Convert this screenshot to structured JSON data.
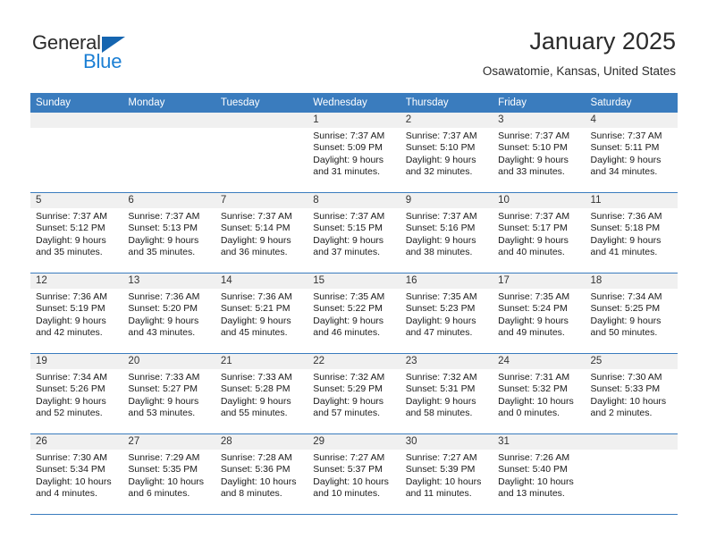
{
  "brand": {
    "word1": "General",
    "word2": "Blue",
    "flag_icon": "triangle-flag-icon",
    "colors": {
      "blue": "#1b7fd4",
      "flag": "#1565b0",
      "dark": "#2b2b2b"
    }
  },
  "header": {
    "title": "January 2025",
    "subtitle": "Osawatomie, Kansas, United States"
  },
  "theme": {
    "header_bar": "#3a7cbe",
    "day_head_bg": "#f0f0f0",
    "cell_bg": "#ffffff",
    "text": "#1a1a1a"
  },
  "weekdays": [
    "Sunday",
    "Monday",
    "Tuesday",
    "Wednesday",
    "Thursday",
    "Friday",
    "Saturday"
  ],
  "weeks": [
    [
      {
        "date": "",
        "empty": true,
        "lines": []
      },
      {
        "date": "",
        "empty": true,
        "lines": []
      },
      {
        "date": "",
        "empty": true,
        "lines": []
      },
      {
        "date": "1",
        "empty": false,
        "lines": [
          "Sunrise: 7:37 AM",
          "Sunset: 5:09 PM",
          "Daylight: 9 hours",
          "and 31 minutes."
        ]
      },
      {
        "date": "2",
        "empty": false,
        "lines": [
          "Sunrise: 7:37 AM",
          "Sunset: 5:10 PM",
          "Daylight: 9 hours",
          "and 32 minutes."
        ]
      },
      {
        "date": "3",
        "empty": false,
        "lines": [
          "Sunrise: 7:37 AM",
          "Sunset: 5:10 PM",
          "Daylight: 9 hours",
          "and 33 minutes."
        ]
      },
      {
        "date": "4",
        "empty": false,
        "lines": [
          "Sunrise: 7:37 AM",
          "Sunset: 5:11 PM",
          "Daylight: 9 hours",
          "and 34 minutes."
        ]
      }
    ],
    [
      {
        "date": "5",
        "empty": false,
        "lines": [
          "Sunrise: 7:37 AM",
          "Sunset: 5:12 PM",
          "Daylight: 9 hours",
          "and 35 minutes."
        ]
      },
      {
        "date": "6",
        "empty": false,
        "lines": [
          "Sunrise: 7:37 AM",
          "Sunset: 5:13 PM",
          "Daylight: 9 hours",
          "and 35 minutes."
        ]
      },
      {
        "date": "7",
        "empty": false,
        "lines": [
          "Sunrise: 7:37 AM",
          "Sunset: 5:14 PM",
          "Daylight: 9 hours",
          "and 36 minutes."
        ]
      },
      {
        "date": "8",
        "empty": false,
        "lines": [
          "Sunrise: 7:37 AM",
          "Sunset: 5:15 PM",
          "Daylight: 9 hours",
          "and 37 minutes."
        ]
      },
      {
        "date": "9",
        "empty": false,
        "lines": [
          "Sunrise: 7:37 AM",
          "Sunset: 5:16 PM",
          "Daylight: 9 hours",
          "and 38 minutes."
        ]
      },
      {
        "date": "10",
        "empty": false,
        "lines": [
          "Sunrise: 7:37 AM",
          "Sunset: 5:17 PM",
          "Daylight: 9 hours",
          "and 40 minutes."
        ]
      },
      {
        "date": "11",
        "empty": false,
        "lines": [
          "Sunrise: 7:36 AM",
          "Sunset: 5:18 PM",
          "Daylight: 9 hours",
          "and 41 minutes."
        ]
      }
    ],
    [
      {
        "date": "12",
        "empty": false,
        "lines": [
          "Sunrise: 7:36 AM",
          "Sunset: 5:19 PM",
          "Daylight: 9 hours",
          "and 42 minutes."
        ]
      },
      {
        "date": "13",
        "empty": false,
        "lines": [
          "Sunrise: 7:36 AM",
          "Sunset: 5:20 PM",
          "Daylight: 9 hours",
          "and 43 minutes."
        ]
      },
      {
        "date": "14",
        "empty": false,
        "lines": [
          "Sunrise: 7:36 AM",
          "Sunset: 5:21 PM",
          "Daylight: 9 hours",
          "and 45 minutes."
        ]
      },
      {
        "date": "15",
        "empty": false,
        "lines": [
          "Sunrise: 7:35 AM",
          "Sunset: 5:22 PM",
          "Daylight: 9 hours",
          "and 46 minutes."
        ]
      },
      {
        "date": "16",
        "empty": false,
        "lines": [
          "Sunrise: 7:35 AM",
          "Sunset: 5:23 PM",
          "Daylight: 9 hours",
          "and 47 minutes."
        ]
      },
      {
        "date": "17",
        "empty": false,
        "lines": [
          "Sunrise: 7:35 AM",
          "Sunset: 5:24 PM",
          "Daylight: 9 hours",
          "and 49 minutes."
        ]
      },
      {
        "date": "18",
        "empty": false,
        "lines": [
          "Sunrise: 7:34 AM",
          "Sunset: 5:25 PM",
          "Daylight: 9 hours",
          "and 50 minutes."
        ]
      }
    ],
    [
      {
        "date": "19",
        "empty": false,
        "lines": [
          "Sunrise: 7:34 AM",
          "Sunset: 5:26 PM",
          "Daylight: 9 hours",
          "and 52 minutes."
        ]
      },
      {
        "date": "20",
        "empty": false,
        "lines": [
          "Sunrise: 7:33 AM",
          "Sunset: 5:27 PM",
          "Daylight: 9 hours",
          "and 53 minutes."
        ]
      },
      {
        "date": "21",
        "empty": false,
        "lines": [
          "Sunrise: 7:33 AM",
          "Sunset: 5:28 PM",
          "Daylight: 9 hours",
          "and 55 minutes."
        ]
      },
      {
        "date": "22",
        "empty": false,
        "lines": [
          "Sunrise: 7:32 AM",
          "Sunset: 5:29 PM",
          "Daylight: 9 hours",
          "and 57 minutes."
        ]
      },
      {
        "date": "23",
        "empty": false,
        "lines": [
          "Sunrise: 7:32 AM",
          "Sunset: 5:31 PM",
          "Daylight: 9 hours",
          "and 58 minutes."
        ]
      },
      {
        "date": "24",
        "empty": false,
        "lines": [
          "Sunrise: 7:31 AM",
          "Sunset: 5:32 PM",
          "Daylight: 10 hours",
          "and 0 minutes."
        ]
      },
      {
        "date": "25",
        "empty": false,
        "lines": [
          "Sunrise: 7:30 AM",
          "Sunset: 5:33 PM",
          "Daylight: 10 hours",
          "and 2 minutes."
        ]
      }
    ],
    [
      {
        "date": "26",
        "empty": false,
        "lines": [
          "Sunrise: 7:30 AM",
          "Sunset: 5:34 PM",
          "Daylight: 10 hours",
          "and 4 minutes."
        ]
      },
      {
        "date": "27",
        "empty": false,
        "lines": [
          "Sunrise: 7:29 AM",
          "Sunset: 5:35 PM",
          "Daylight: 10 hours",
          "and 6 minutes."
        ]
      },
      {
        "date": "28",
        "empty": false,
        "lines": [
          "Sunrise: 7:28 AM",
          "Sunset: 5:36 PM",
          "Daylight: 10 hours",
          "and 8 minutes."
        ]
      },
      {
        "date": "29",
        "empty": false,
        "lines": [
          "Sunrise: 7:27 AM",
          "Sunset: 5:37 PM",
          "Daylight: 10 hours",
          "and 10 minutes."
        ]
      },
      {
        "date": "30",
        "empty": false,
        "lines": [
          "Sunrise: 7:27 AM",
          "Sunset: 5:39 PM",
          "Daylight: 10 hours",
          "and 11 minutes."
        ]
      },
      {
        "date": "31",
        "empty": false,
        "lines": [
          "Sunrise: 7:26 AM",
          "Sunset: 5:40 PM",
          "Daylight: 10 hours",
          "and 13 minutes."
        ]
      },
      {
        "date": "",
        "empty": true,
        "lines": []
      }
    ]
  ]
}
